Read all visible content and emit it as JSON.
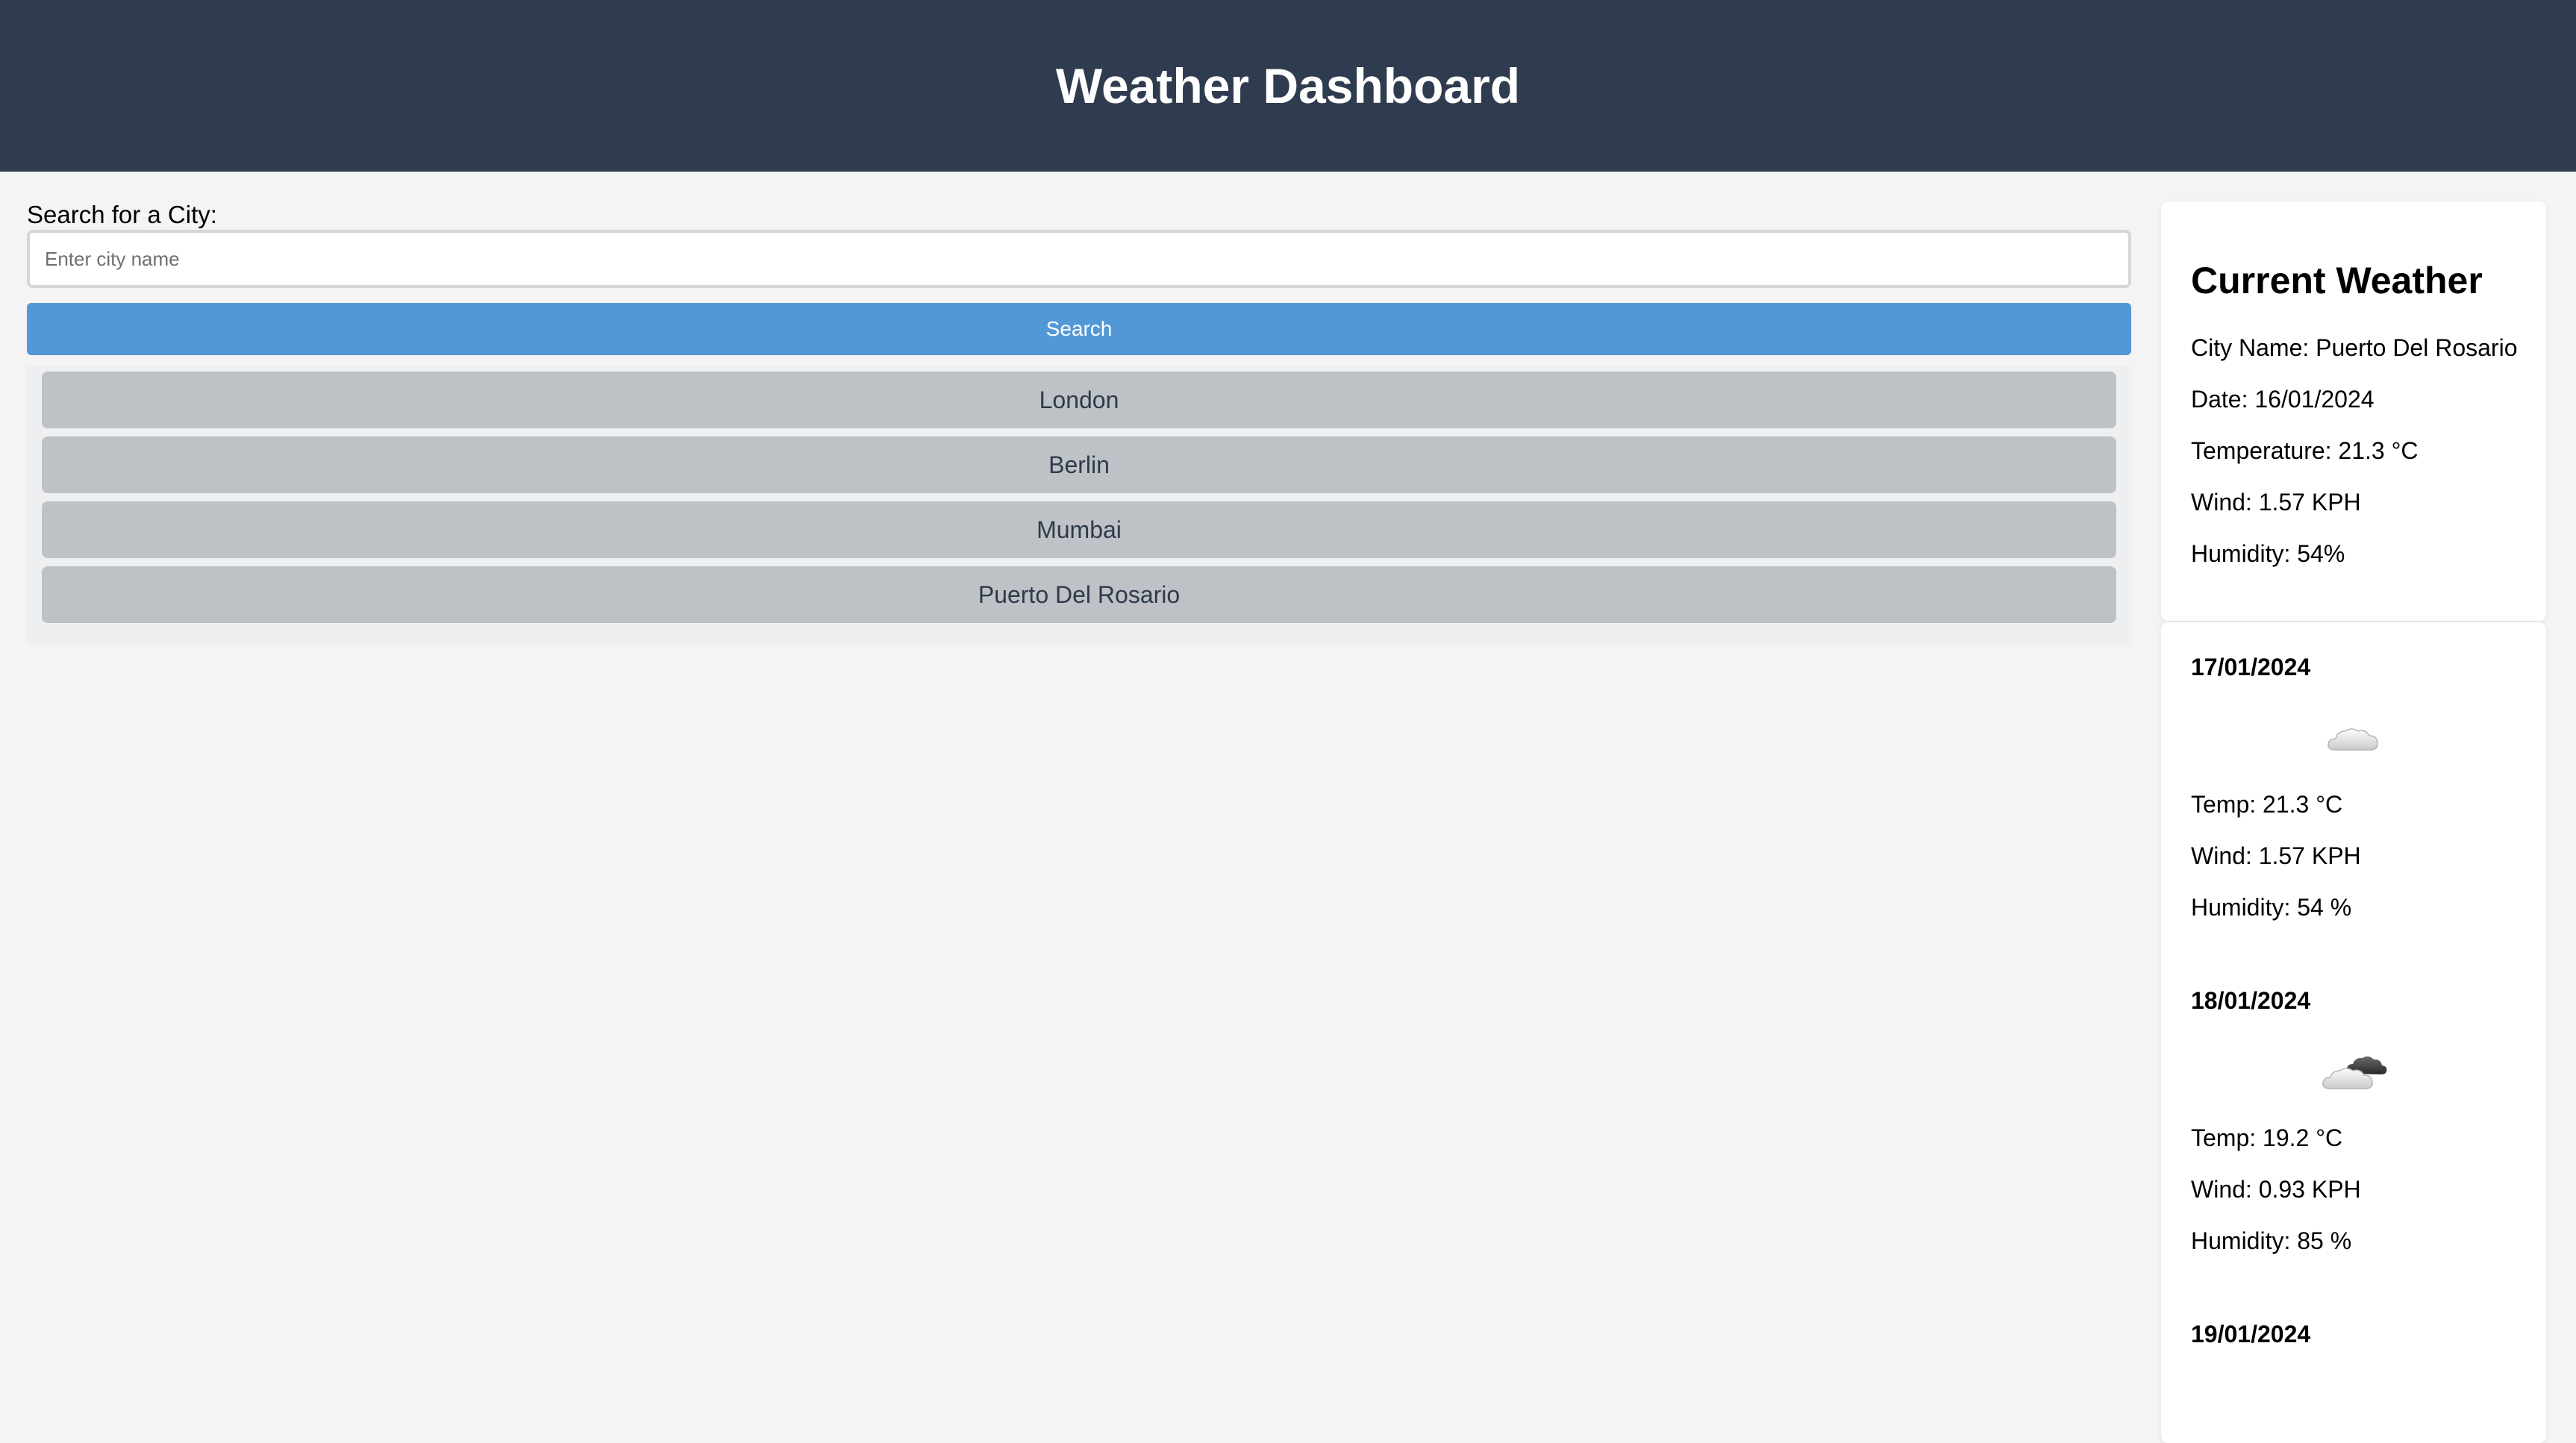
{
  "header": {
    "title": "Weather Dashboard"
  },
  "search": {
    "label": "Search for a City:",
    "placeholder": "Enter city name",
    "value": "",
    "button_label": "Search"
  },
  "history": {
    "items": [
      {
        "label": "London"
      },
      {
        "label": "Berlin"
      },
      {
        "label": "Mumbai"
      },
      {
        "label": "Puerto Del Rosario"
      }
    ]
  },
  "current": {
    "title": "Current Weather",
    "city": "City Name: Puerto Del Rosario",
    "date": "Date: 16/01/2024",
    "temperature": "Temperature: 21.3 °C",
    "wind": "Wind: 1.57 KPH",
    "humidity": "Humidity: 54%"
  },
  "forecast": {
    "days": [
      {
        "date": "17/01/2024",
        "icon": "cloud-icon",
        "temp": "Temp: 21.3 °C",
        "wind": "Wind: 1.57 KPH",
        "humidity": "Humidity: 54 %"
      },
      {
        "date": "18/01/2024",
        "icon": "broken-clouds-icon",
        "temp": "Temp: 19.2 °C",
        "wind": "Wind: 0.93 KPH",
        "humidity": "Humidity: 85 %"
      },
      {
        "date": "19/01/2024"
      }
    ]
  },
  "colors": {
    "header_bg": "#2f3c4f",
    "search_button": "#5398d6",
    "history_item": "#bec2c6",
    "page_bg": "#f4f4f4"
  }
}
